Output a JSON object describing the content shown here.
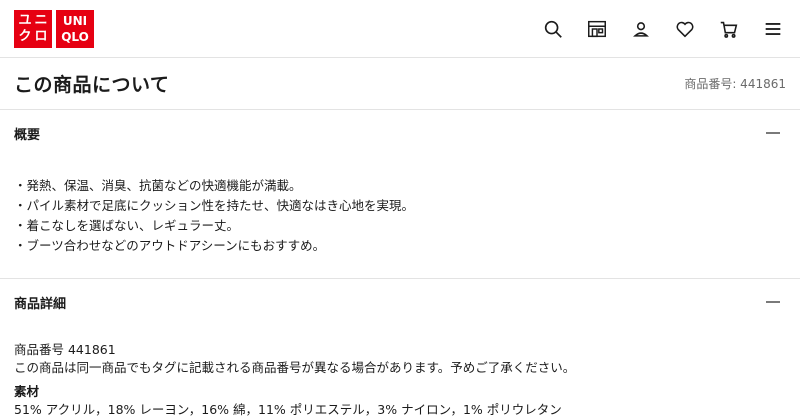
{
  "header": {
    "logo_jp": [
      "ユ",
      "ニ",
      "ク",
      "ロ"
    ],
    "logo_en": [
      "UNI",
      "QLO"
    ],
    "icons": [
      "search-icon",
      "store-icon",
      "account-icon",
      "heart-icon",
      "cart-icon",
      "menu-icon"
    ]
  },
  "page": {
    "title": "この商品について",
    "product_number": "商品番号: 441861"
  },
  "overview": {
    "title": "概要",
    "bullets": [
      "・発熱、保温、消臭、抗菌などの快適機能が満載。",
      "・パイル素材で足底にクッション性を持たせ、快適なはき心地を実現。",
      "・着こなしを選ばない、レギュラー丈。",
      "・ブーツ合わせなどのアウトドアシーンにもおすすめ。"
    ]
  },
  "details": {
    "title": "商品詳細",
    "product_number": "商品番号 441861",
    "note": "この商品は同一商品でもタグに記載される商品番号が異なる場合があります。予めご了承ください。",
    "material_title": "素材",
    "material": "51% アクリル，18% レーヨン，16% 綿，11% ポリエステル，3% ナイロン，1% ポリウレタン"
  },
  "colors": {
    "brand": "#e60012",
    "divider": "#e3e3e3"
  }
}
